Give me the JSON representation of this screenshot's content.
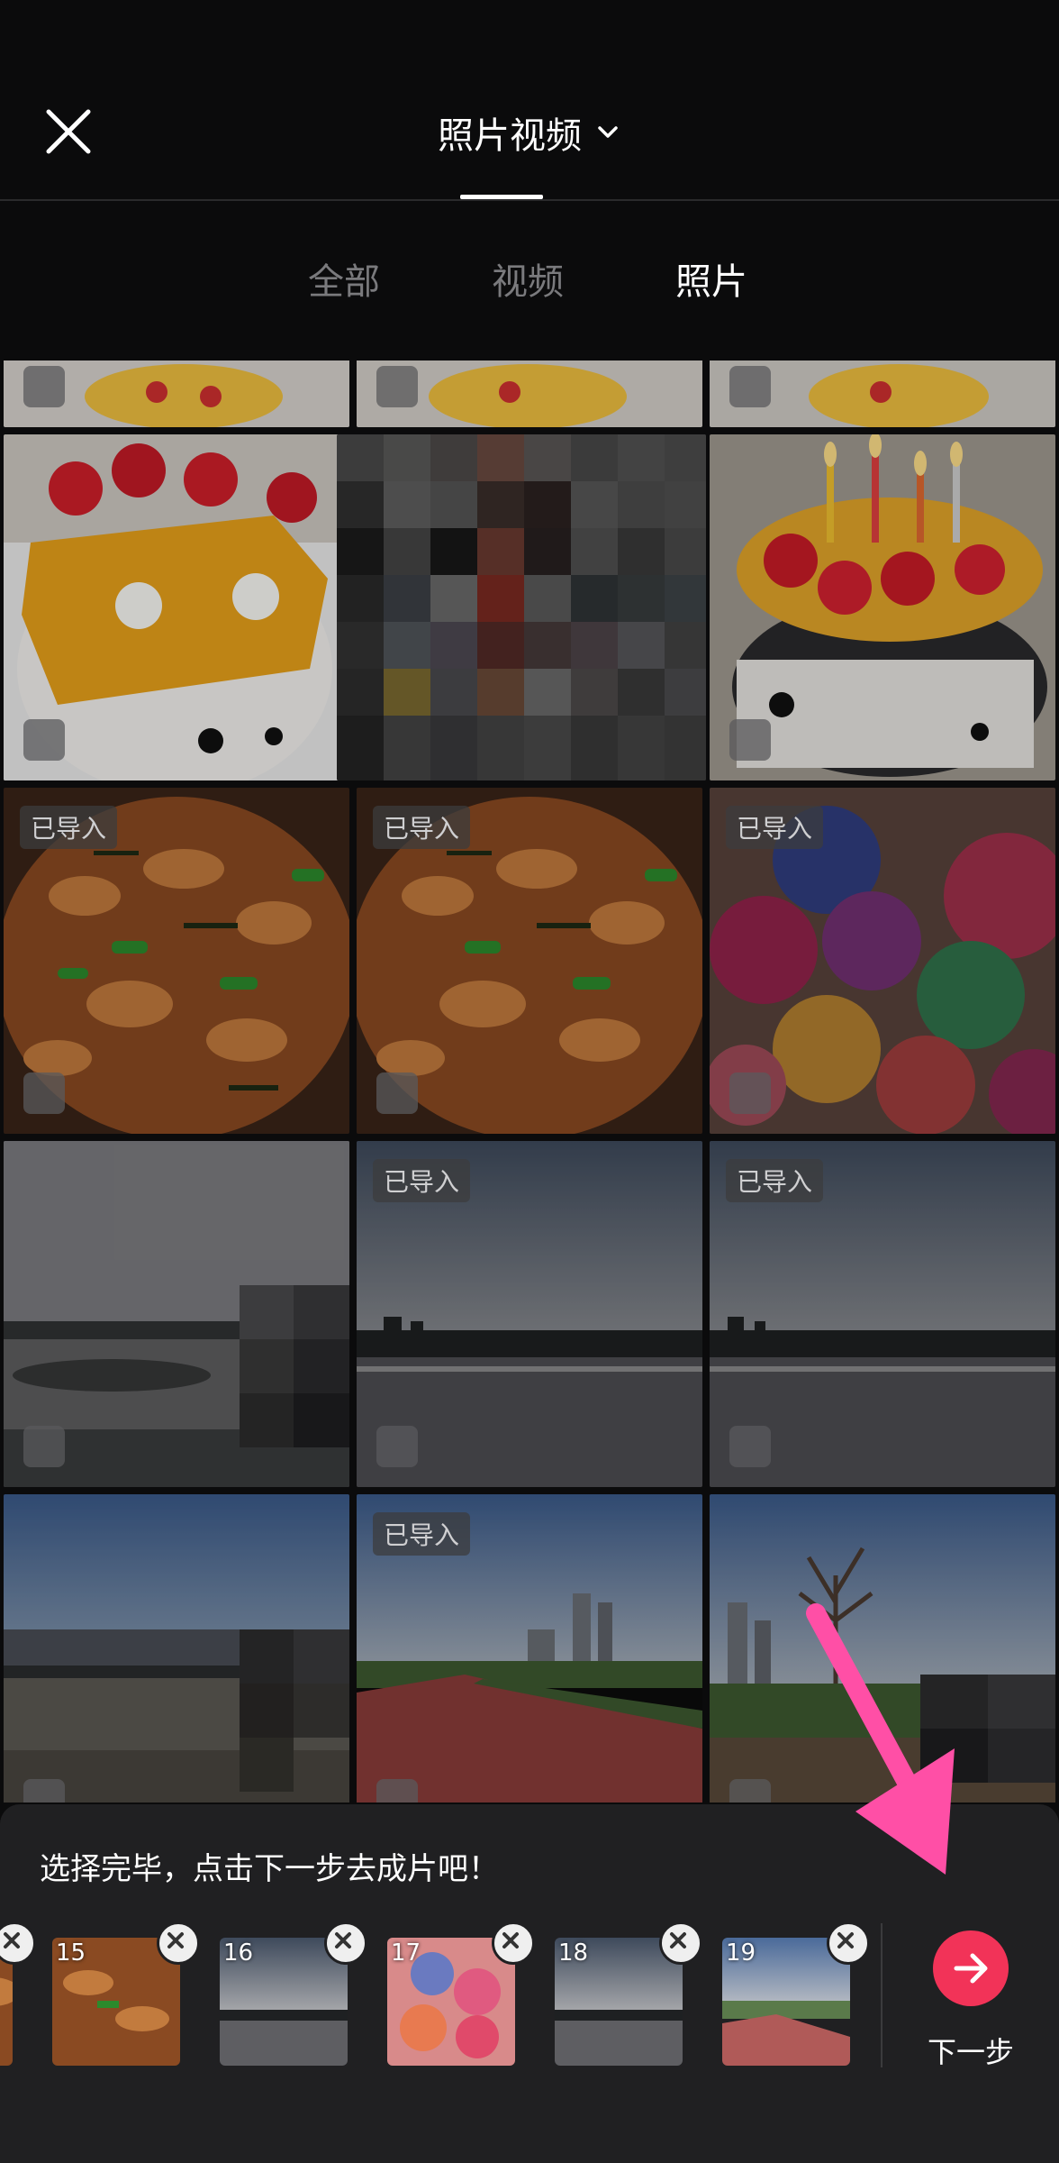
{
  "header": {
    "title": "照片视频",
    "close_icon": "close-icon",
    "dropdown_icon": "chevron-down-icon"
  },
  "tabs": [
    {
      "label": "全部",
      "active": false
    },
    {
      "label": "视频",
      "active": false
    },
    {
      "label": "照片",
      "active": true
    }
  ],
  "grid": {
    "imported_label": "已导入",
    "items": [
      {
        "id": "r0c0",
        "kind": "cake",
        "imported": false
      },
      {
        "id": "r0c1",
        "kind": "cake",
        "imported": false
      },
      {
        "id": "r0c2",
        "kind": "cake",
        "imported": false
      },
      {
        "id": "r1c0",
        "kind": "mango-cake",
        "imported": false
      },
      {
        "id": "r1c1",
        "kind": "pixelated",
        "imported": false
      },
      {
        "id": "r1c2",
        "kind": "candle-cake",
        "imported": false
      },
      {
        "id": "r2c0",
        "kind": "stir-fry",
        "imported": true
      },
      {
        "id": "r2c1",
        "kind": "stir-fry",
        "imported": true
      },
      {
        "id": "r2c2",
        "kind": "balloons",
        "imported": true
      },
      {
        "id": "r3c0",
        "kind": "river",
        "imported": false
      },
      {
        "id": "r3c1",
        "kind": "river",
        "imported": true
      },
      {
        "id": "r3c2",
        "kind": "river",
        "imported": true
      },
      {
        "id": "r4c0",
        "kind": "bridge",
        "imported": false
      },
      {
        "id": "r4c1",
        "kind": "track",
        "imported": true
      },
      {
        "id": "r4c2",
        "kind": "skyline-tree",
        "imported": false
      }
    ]
  },
  "bottom_sheet": {
    "hint": "选择完毕，点击下一步去成片吧！",
    "selected": [
      {
        "num": "15",
        "kind": "stir-fry"
      },
      {
        "num": "16",
        "kind": "river"
      },
      {
        "num": "17",
        "kind": "balloons"
      },
      {
        "num": "18",
        "kind": "river"
      },
      {
        "num": "19",
        "kind": "track"
      }
    ],
    "next_label": "下一步",
    "next_icon": "arrow-right-icon"
  },
  "overlay": {
    "pointer_icon": "pink-arrow-icon",
    "pointer_color": "#ff4fa6"
  },
  "colors": {
    "accent": "#f23358",
    "background": "#0b0b0c",
    "sheet": "#202022"
  }
}
